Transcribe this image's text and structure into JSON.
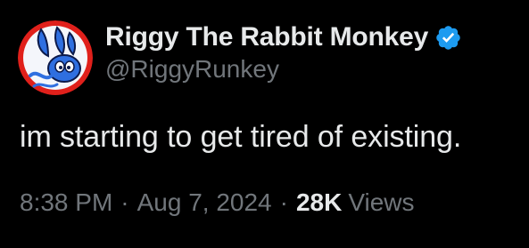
{
  "author": {
    "display_name": "Riggy The Rabbit Monkey",
    "handle": "@RiggyRunkey",
    "verified_icon": "verified-badge-icon",
    "avatar_icon": "avatar-image"
  },
  "tweet": {
    "text": "im starting to get tired of existing."
  },
  "meta": {
    "time": "8:38 PM",
    "separator1": "·",
    "date": "Aug 7, 2024",
    "separator2": "·",
    "views_count": "28K",
    "views_label": "Views"
  },
  "colors": {
    "background": "#000000",
    "primary_text": "#e7e9ea",
    "secondary_text": "#71767b",
    "verified_blue": "#1d9bf0",
    "avatar_red": "#e0201b",
    "avatar_blue": "#2f6fe0"
  }
}
